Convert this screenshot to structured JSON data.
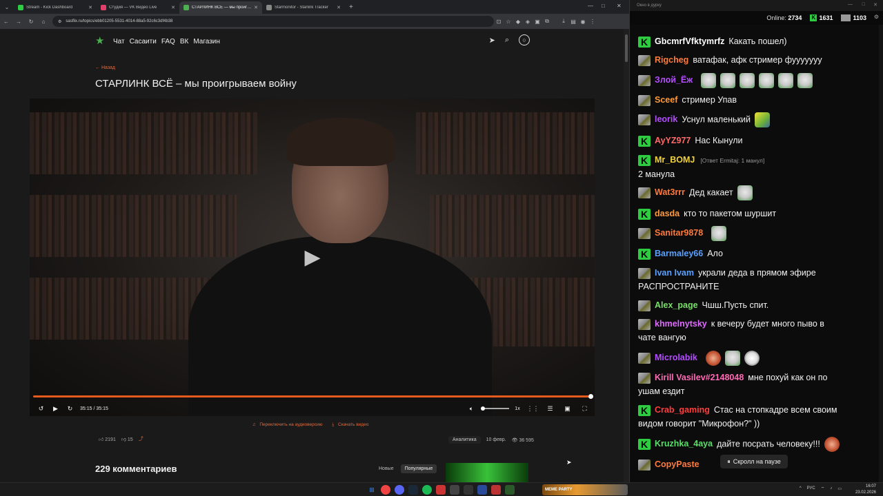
{
  "browser": {
    "tabs": [
      {
        "label": "Stream - Kick Dashboard",
        "fav": "#2ecc40",
        "active": false
      },
      {
        "label": "Студия — VK Видео Live",
        "fav": "#e0406a",
        "active": false
      },
      {
        "label": "СТАРЛИНК ВСЁ — мы проигр…",
        "fav": "#4caf50",
        "active": true
      },
      {
        "label": "Starmonitor - Starlink Tracker",
        "fav": "#888888",
        "active": false
      }
    ],
    "url": "sasflix.ru/topics/ebb01205-5531-4014-88a5-92c6c3df4b38"
  },
  "site": {
    "nav": [
      "Чат",
      "Сасаити",
      "FAQ",
      "ВК",
      "Магазин"
    ],
    "back": "← Назад",
    "title": "СТАРЛИНК ВСЁ – мы проигрываем войну",
    "player": {
      "time": "35:15 / 35:15",
      "progress": 1.0,
      "volume": 0.1,
      "speed": "1x"
    },
    "links": {
      "switch": "Переключить на аудиоверсию",
      "download": "Скачать видео"
    },
    "likes": "2191",
    "dislikes": "15",
    "analytics": "Аналитика",
    "date": "10 февр.",
    "views": "36 595",
    "comments_title": "229 комментариев",
    "sort_new": "Новые",
    "sort_popular": "Популярные"
  },
  "chat": {
    "window_title": "Окно в дурку",
    "online_label": "Online:",
    "online": "2734",
    "kick_count": "1631",
    "other_count": "1103",
    "messages": [
      {
        "badge": "k",
        "user": "GbcmrfVfktymrfz",
        "color": "#ffffff",
        "text": "Какать пошел)",
        "emotes": []
      },
      {
        "badge": "g",
        "user": "Rigcheg",
        "color": "#ff7a3d",
        "text": "ватафак, афк стример фууууууу",
        "emotes": []
      },
      {
        "badge": "g",
        "user": "Злой_Ёж",
        "color": "#b44dff",
        "text": "",
        "emotes": [
          "e",
          "e",
          "e",
          "e",
          "e",
          "e"
        ]
      },
      {
        "badge": "g",
        "user": "Sceef",
        "color": "#ff9a3d",
        "text": "стример Упав",
        "emotes": []
      },
      {
        "badge": "g",
        "user": "leorik",
        "color": "#b44dff",
        "text": "Уснул маленький",
        "emotes": [
          "y"
        ]
      },
      {
        "badge": "k",
        "user": "AyYZ977",
        "color": "#ff6a6a",
        "text": "Нас Кынули",
        "emotes": []
      },
      {
        "badge": "k",
        "user": "Mr_BOMJ",
        "color": "#f0d23c",
        "text": "",
        "reply": "[Ответ Ermitaj: 1 манул]",
        "text2": "2 манула",
        "emotes": []
      },
      {
        "badge": "g",
        "user": "Wat3rrr",
        "color": "#ff7a3d",
        "text": "Дед какает",
        "emotes": [
          "e"
        ]
      },
      {
        "badge": "k",
        "user": "dasda",
        "color": "#ff9a3d",
        "text": "кто то пакетом шуршит",
        "emotes": []
      },
      {
        "badge": "g",
        "user": "Sanitar9878",
        "color": "#ff7a3d",
        "text": "",
        "emotes": [
          "e"
        ]
      },
      {
        "badge": "k",
        "user": "Barmaley66",
        "color": "#5aa0ff",
        "text": "Ало",
        "emotes": []
      },
      {
        "badge": "g",
        "user": "Ivan Ivam",
        "color": "#5aa0ff",
        "text": "украли деда в прямом эфире",
        "text2": "РАСПРОСТРАНИТЕ",
        "emotes": []
      },
      {
        "badge": "g",
        "user": "Alex_page",
        "color": "#7adf6a",
        "text": "Чшш.Пусть спит.",
        "emotes": []
      },
      {
        "badge": "g",
        "user": "khmelnytsky",
        "color": "#e06aff",
        "text": "к вечеру будет много пыво в",
        "text2": "чате вангую",
        "emotes": []
      },
      {
        "badge": "g",
        "user": "Microlabik",
        "color": "#b44dff",
        "text": "",
        "emotes": [
          "r",
          "e",
          "j"
        ]
      },
      {
        "badge": "g",
        "user": "Kirill Vasilev#2148048",
        "color": "#ff6ab4",
        "text": "мне похуй как он по",
        "text2": "ушам ездит",
        "emotes": []
      },
      {
        "badge": "k",
        "user": "Crab_gaming",
        "color": "#ff3d3d",
        "text": "Стас на стопкадре всем своим",
        "text2": "видом говорит \"Микрофон?\" ))",
        "emotes": []
      },
      {
        "badge": "k",
        "user": "Kruzhka_4aya",
        "color": "#5adf6a",
        "text": "дайте посрать человеку!!!",
        "emotes": [
          "r"
        ]
      },
      {
        "badge": "g",
        "user": "CopyPaste",
        "color": "#ff7a3d",
        "text": "",
        "emotes": []
      }
    ],
    "pause_label": "Скролл на паузе"
  },
  "taskbar": {
    "meme": "MEME PARTY",
    "lang": "РУС",
    "time": "16:07",
    "date": "23.02.2026"
  }
}
